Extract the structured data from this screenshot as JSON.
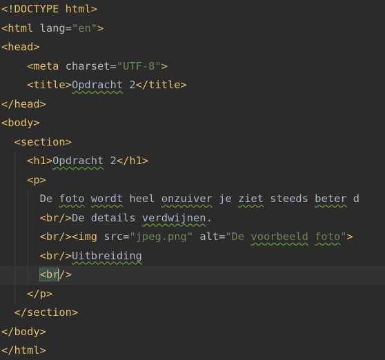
{
  "editor": {
    "l1": {
      "tag": "<!DOCTYPE html>"
    },
    "l2": {
      "open": "<html",
      "attr": " lang=",
      "val": "\"en\"",
      "close": ">"
    },
    "l3": {
      "tag": "<head>"
    },
    "l4": {
      "open": "<meta",
      "attr": " charset=",
      "val": "\"UTF-8\"",
      "close": ">"
    },
    "l5": {
      "open": "<title>",
      "text": "Opdracht",
      "text2": " 2",
      "close": "</title>"
    },
    "l6": {
      "tag": "</head>"
    },
    "l7": {
      "tag": "<body>"
    },
    "l8": {
      "tag": "<section>"
    },
    "l9": {
      "open": "<h1>",
      "text": "Opdracht",
      "text2": " 2",
      "close": "</h1>"
    },
    "l10": {
      "tag": "<p>"
    },
    "l11": {
      "t1": "De ",
      "w1": "foto",
      "t2": " ",
      "w2": "wordt",
      "t3": " heel ",
      "w3": "onzuiver",
      "t4": " je ",
      "w4": "ziet",
      "t5": " steeds ",
      "w5": "beter",
      "t6": " d"
    },
    "l12": {
      "br": "<br/>",
      "t1": "De details ",
      "w1": "verdwijnen",
      "t2": "."
    },
    "l13": {
      "br": "<br/>",
      "img": "<img",
      "a1": " src=",
      "v1": "\"jpeg.png\"",
      "a2": " alt=",
      "v2q": "\"De ",
      "v2w1": "voorbeeld",
      "v2s": " ",
      "v2w2": "foto",
      "v2e": "\"",
      "close": ">"
    },
    "l14": {
      "br": "<br/>",
      "w1": "Uitbreiding"
    },
    "l15": {
      "open": "<br",
      "close": "/>"
    },
    "l16": {
      "tag": "</p>"
    },
    "l17": {
      "tag": "</section>"
    },
    "l18": {
      "tag": "</body>"
    },
    "l19": {
      "tag": "</html>"
    }
  }
}
